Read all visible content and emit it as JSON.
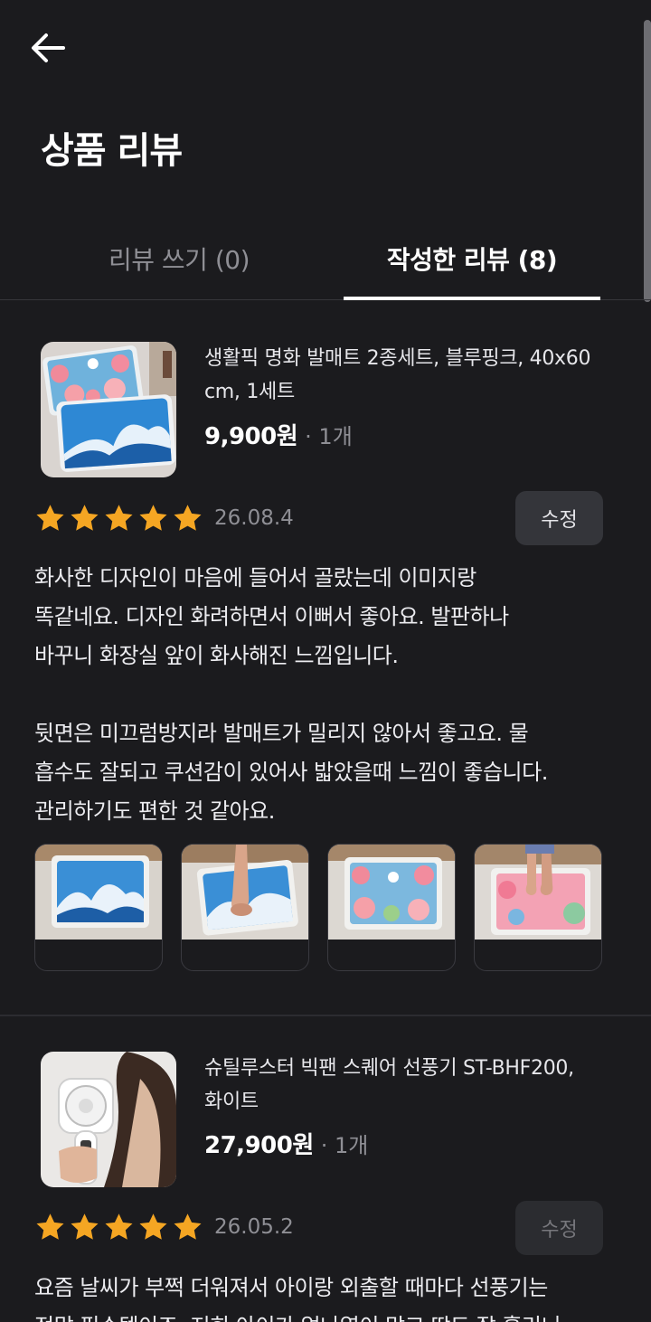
{
  "header": {
    "title": "상품 리뷰",
    "back_icon": "arrow-left-icon"
  },
  "tabs": [
    {
      "label": "리뷰 쓰기 (0)",
      "active": false
    },
    {
      "label": "작성한 리뷰 (8)",
      "active": true
    }
  ],
  "reviews": [
    {
      "product_name_lines": [
        "생활픽 명화 발매트 2종세트, 블루핑크, 40x60",
        "cm, 1세트"
      ],
      "price": "9,900원",
      "quantity": "· 1개",
      "rating": 5,
      "date": "26.08.4",
      "edit_label": "수정",
      "text_lines": [
        "화사한 디자인이 마음에 들어서 골랐는데 이미지랑",
        "똑같네요. 디자인 화려하면서 이뻐서 좋아요. 발판하나",
        "바꾸니 화장실 앞이 화사해진 느낌입니다.",
        "",
        "뒷면은 미끄럼방지라 발매트가 밀리지 않아서 좋고요. 물",
        "흡수도 잘되고 쿠션감이 있어사 밟았을때 느낌이 좋습니다.",
        "관리하기도 편한 것 같아요."
      ],
      "photo_count": 4
    },
    {
      "product_name_lines": [
        "슈틸루스터 빅팬 스퀘어 선풍기 ST-BHF200,",
        "화이트"
      ],
      "price": "27,900원",
      "quantity": "· 1개",
      "rating": 5,
      "date": "26.05.2",
      "edit_label": "수정",
      "text_lines": [
        "요즘 날씨가 부쩍 더워져서 아이랑 외출할 때마다 선풍기는",
        "정말 필수템이죠. 저희 아이가 얼나열이 많고 땀도 잘 흘리니"
      ]
    }
  ],
  "colors": {
    "background": "#1b1b1e",
    "star": "#f5a623",
    "tab_active": "#ffffff",
    "tab_inactive": "#8f8f95"
  }
}
